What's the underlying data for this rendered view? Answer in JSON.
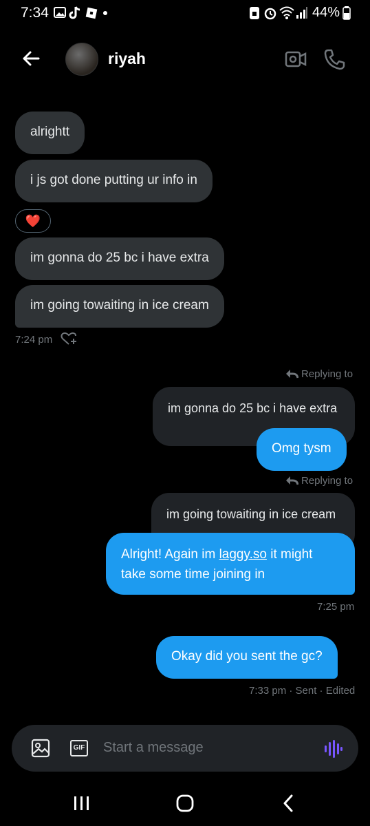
{
  "status_bar": {
    "time": "7:34",
    "battery": "44%"
  },
  "header": {
    "contact_name": "riyah"
  },
  "incoming": [
    "alrightt",
    "i js got done putting ur info in",
    "im gonna do 25 bc i have extra",
    "im going towaiting in ice cream"
  ],
  "reaction_emoji": "❤️",
  "incoming_time": "7:24 pm",
  "replies": [
    {
      "label": "Replying to",
      "quoted": "im gonna do 25 bc i have extra",
      "text": "Omg tysm"
    },
    {
      "label": "Replying to",
      "quoted": "im going towaiting in ice cream",
      "text_before": "Alright! Again im ",
      "link": "laggy.so",
      "text_after": " it might",
      "line2": "take some time joining in"
    }
  ],
  "time_725": "7:25 pm",
  "last_message": "Okay did you sent the gc?",
  "last_meta": "7:33 pm · Sent · Edited",
  "composer": {
    "placeholder": "Start a message",
    "gif_label": "GIF"
  },
  "colors": {
    "accent": "#1d9bf0",
    "incoming_bubble": "#2f3336",
    "background": "#000000"
  }
}
